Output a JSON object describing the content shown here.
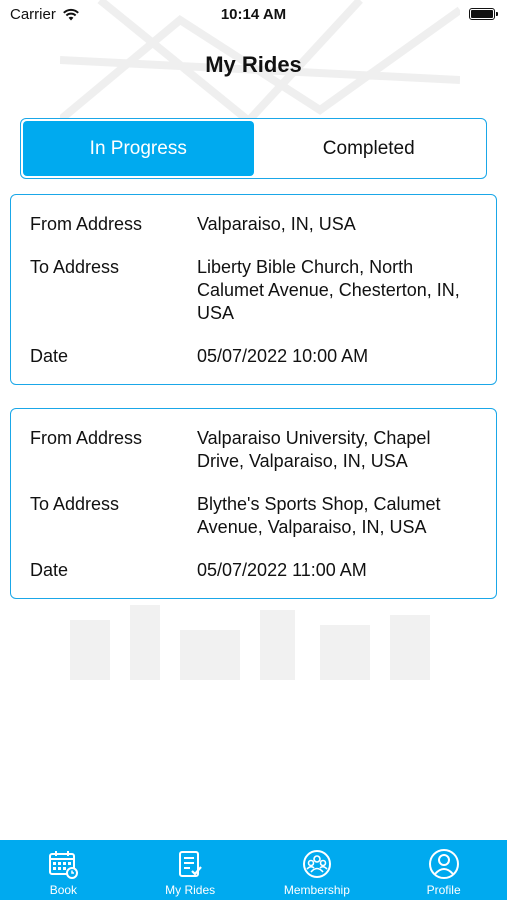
{
  "status_bar": {
    "carrier": "Carrier",
    "time": "10:14 AM"
  },
  "title": "My Rides",
  "segments": [
    {
      "label": "In Progress",
      "active": true
    },
    {
      "label": "Completed",
      "active": false
    }
  ],
  "rides": [
    {
      "from_label": "From Address",
      "from_value": "Valparaiso, IN, USA",
      "to_label": "To Address",
      "to_value": "Liberty Bible Church, North Calumet Avenue, Chesterton, IN, USA",
      "date_label": "Date",
      "date_value": "05/07/2022 10:00 AM"
    },
    {
      "from_label": "From Address",
      "from_value": "Valparaiso University, Chapel Drive, Valparaiso, IN, USA",
      "to_label": "To Address",
      "to_value": "Blythe's Sports Shop, Calumet Avenue, Valparaiso, IN, USA",
      "date_label": "Date",
      "date_value": "05/07/2022 11:00 AM"
    }
  ],
  "tab_bar": {
    "items": [
      {
        "label": "Book",
        "icon": "calendar-icon"
      },
      {
        "label": "My Rides",
        "icon": "rides-list-icon"
      },
      {
        "label": "Membership",
        "icon": "membership-icon"
      },
      {
        "label": "Profile",
        "icon": "profile-icon"
      }
    ]
  },
  "colors": {
    "accent": "#00aaef",
    "border": "#1aa7e8",
    "text": "#111111"
  }
}
